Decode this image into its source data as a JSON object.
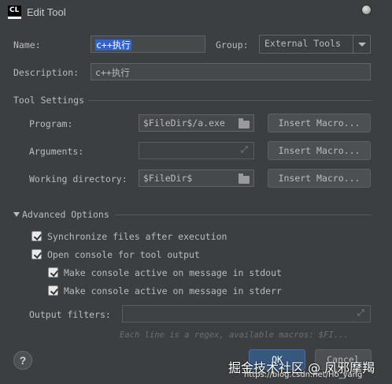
{
  "window": {
    "logo": "CL",
    "title": "Edit Tool"
  },
  "form": {
    "name_label": "Name:",
    "name_value": "c++执行",
    "group_label": "Group:",
    "group_value": "External Tools",
    "description_label": "Description:",
    "description_value": "c++执行"
  },
  "tool_settings": {
    "heading": "Tool Settings",
    "program_label": "Program:",
    "program_value": "$FileDir$/a.exe",
    "arguments_label": "Arguments:",
    "arguments_value": "",
    "working_dir_label": "Working directory:",
    "working_dir_value": "$FileDir$",
    "insert_macro_label": "Insert Macro..."
  },
  "advanced": {
    "heading": "Advanced Options",
    "options": [
      {
        "label": "Synchronize files after execution",
        "checked": true
      },
      {
        "label": "Open console for tool output",
        "checked": true
      },
      {
        "label": "Make console active on message in stdout",
        "checked": true
      },
      {
        "label": "Make console active on message in stderr",
        "checked": true
      }
    ],
    "output_filters_label": "Output filters:",
    "output_filters_value": "",
    "hint": "Each line is a regex, available macros: $FI..."
  },
  "footer": {
    "help_label": "?",
    "ok_label": "OK",
    "cancel_label": "Cancel"
  },
  "watermark": {
    "text": "掘金技术社区 @ 凤邪摩羯",
    "url": "https://blog.csdn.net/Ho_yang"
  }
}
